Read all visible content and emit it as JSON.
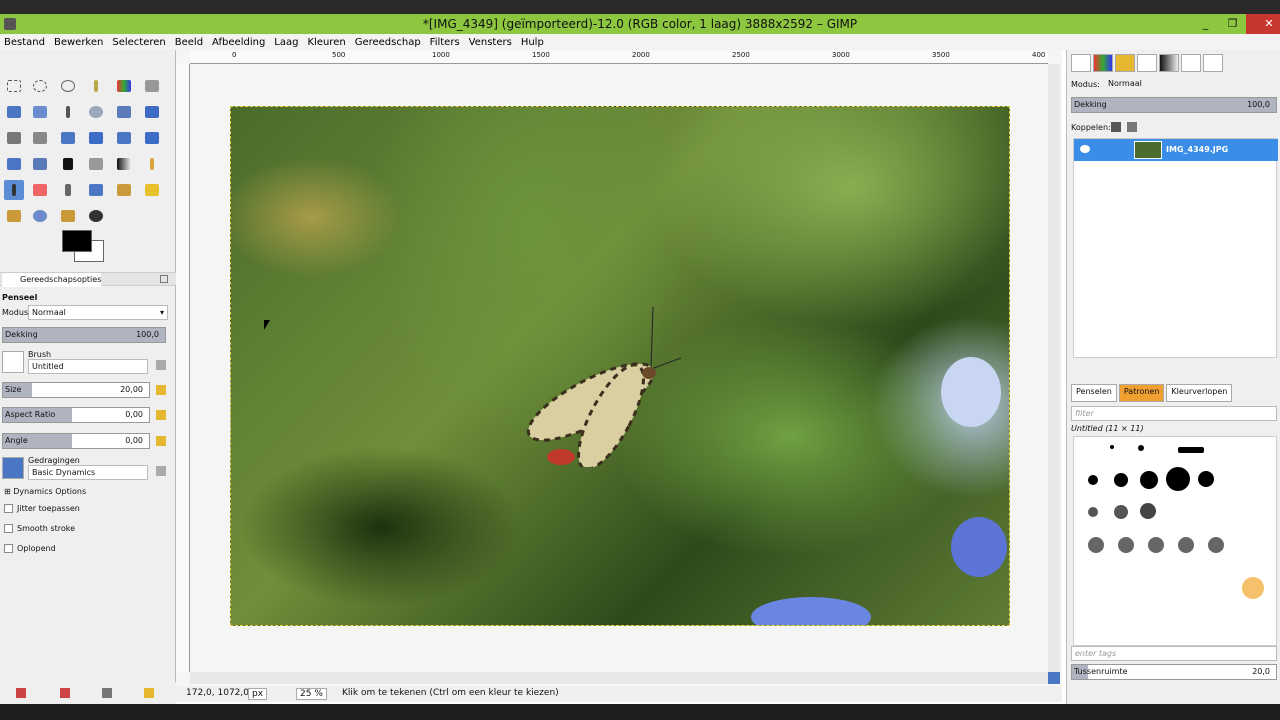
{
  "window": {
    "title": "*[IMG_4349] (geïmporteerd)-12.0 (RGB color, 1 laag) 3888x2592 – GIMP",
    "minimize": "_",
    "maximize": "❐",
    "close": "✕"
  },
  "menu": [
    "Bestand",
    "Bewerken",
    "Selecteren",
    "Beeld",
    "Afbeelding",
    "Laag",
    "Kleuren",
    "Gereedschap",
    "Filters",
    "Vensters",
    "Hulp"
  ],
  "toolbox": {
    "panel_tab": "Gereedschapsopties",
    "tool_name": "Penseel",
    "mode_label": "Modus:",
    "mode_value": "Normaal",
    "opacity_label": "Dekking",
    "opacity_value": "100,0",
    "brush_label": "Brush",
    "brush_value": "Untitled",
    "size_label": "Size",
    "size_value": "20,00",
    "aspect_label": "Aspect Ratio",
    "aspect_value": "0,00",
    "angle_label": "Angle",
    "angle_value": "0,00",
    "dynamics_label": "Gedragingen",
    "dynamics_value": "Basic Dynamics",
    "dynamics_options": "Dynamics Options",
    "jitter": "Jitter toepassen",
    "smooth": "Smooth stroke",
    "incremental": "Oplopend"
  },
  "ruler": {
    "h_ticks": [
      "0",
      "500",
      "1000",
      "1500",
      "2000",
      "2500",
      "3000",
      "3500",
      "400"
    ]
  },
  "status": {
    "coords": "172,0, 1072,0",
    "unit": "px",
    "zoom": "25 %",
    "message": "Klik om te tekenen (Ctrl om een kleur te kiezen)"
  },
  "layers": {
    "mode_label": "Modus:",
    "mode_value": "Normaal",
    "opacity_label": "Dekking",
    "opacity_value": "100,0",
    "lock_label": "Koppelen:",
    "layer_name": "IMG_4349.JPG"
  },
  "brushes": {
    "tabs": [
      "Penselen",
      "Patronen",
      "Kleurverlopen"
    ],
    "filter_placeholder": "filter",
    "selected": "Untitled (11 × 11)",
    "tags_placeholder": "enter tags",
    "spacing_label": "Tussenruimte",
    "spacing_value": "20,0"
  }
}
